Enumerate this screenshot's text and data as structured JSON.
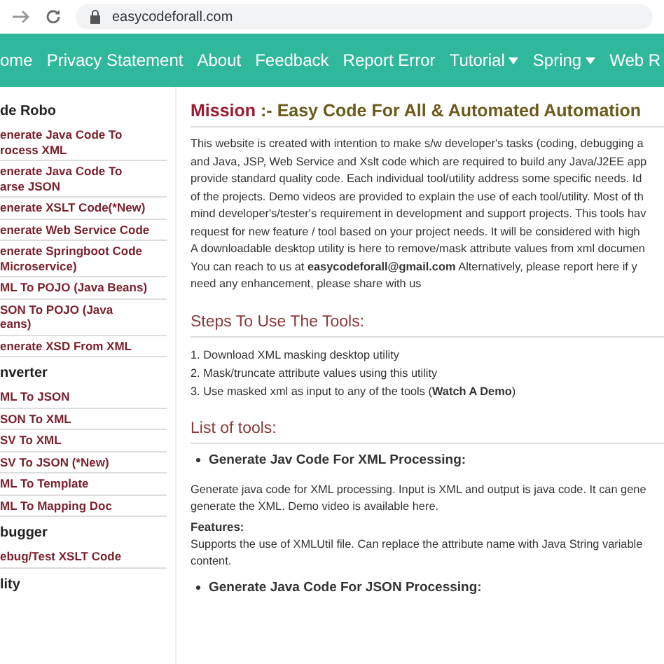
{
  "browser": {
    "url": "easycodeforall.com"
  },
  "nav": [
    {
      "label": "ome",
      "dropdown": false
    },
    {
      "label": "Privacy Statement",
      "dropdown": false
    },
    {
      "label": "About",
      "dropdown": false
    },
    {
      "label": "Feedback",
      "dropdown": false
    },
    {
      "label": "Report Error",
      "dropdown": false
    },
    {
      "label": "Tutorial",
      "dropdown": true
    },
    {
      "label": "Spring",
      "dropdown": true
    },
    {
      "label": "Web R",
      "dropdown": false
    }
  ],
  "sidebar": [
    {
      "heading": "de Robo",
      "items": [
        "enerate Java Code To\nrocess XML",
        "enerate Java Code To\narse JSON",
        "enerate XSLT Code(*New)",
        "enerate Web Service Code",
        "enerate Springboot Code\nMicroservice)",
        "ML To POJO (Java Beans)",
        "SON To POJO (Java\neans)",
        "enerate XSD From XML"
      ]
    },
    {
      "heading": "nverter",
      "items": [
        "ML To JSON",
        "SON To XML",
        "SV To XML",
        "SV To JSON (*New)",
        "ML To Template",
        "ML To Mapping Doc"
      ]
    },
    {
      "heading": "bugger",
      "items": [
        "ebug/Test XSLT Code"
      ]
    },
    {
      "heading": "lity"
    }
  ],
  "mission": {
    "label": "Mission",
    "title": ":- Easy Code For All & Automated Automation",
    "paragraph": [
      "This website is created with intention to make s/w developer's tasks (coding, debugging a",
      "and Java, JSP, Web Service and Xslt code which are required to build any Java/J2EE app",
      "provide standard quality code. Each individual tool/utility address some specific needs. Id",
      "of the projects. Demo videos are provided to explain the use of each tool/utility. Most of th",
      "mind developer's/tester's requirement in development and support projects. This tools hav",
      "request for new feature / tool based on your project needs. It will be considered with high",
      "A downloadable desktop utility is here to remove/mask attribute values from xml documen",
      "You can reach to us at **easycodeforall@gmail.com** Alternatively, please report here if y",
      "need any enhancement, please share with us"
    ]
  },
  "steps": {
    "title": "Steps To Use The Tools:",
    "items": [
      "1. Download XML masking desktop utility",
      "2. Mask/truncate attribute values using this utility",
      "3. Use masked xml as input to any of the tools (**Watch A Demo**)"
    ]
  },
  "tools": {
    "title": "List of tools:",
    "entries": [
      {
        "title": "Generate Jav Code For XML Processing:",
        "description": [
          "Generate java code for XML processing. Input is XML and output is java code. It can gene",
          "generate the XML. Demo video is available here."
        ],
        "features_label": "Features:",
        "features": [
          "Supports the use of XMLUtil file. Can replace the attribute name with Java String variable",
          "content."
        ]
      },
      {
        "title": "Generate Java Code For JSON Processing:"
      }
    ]
  }
}
